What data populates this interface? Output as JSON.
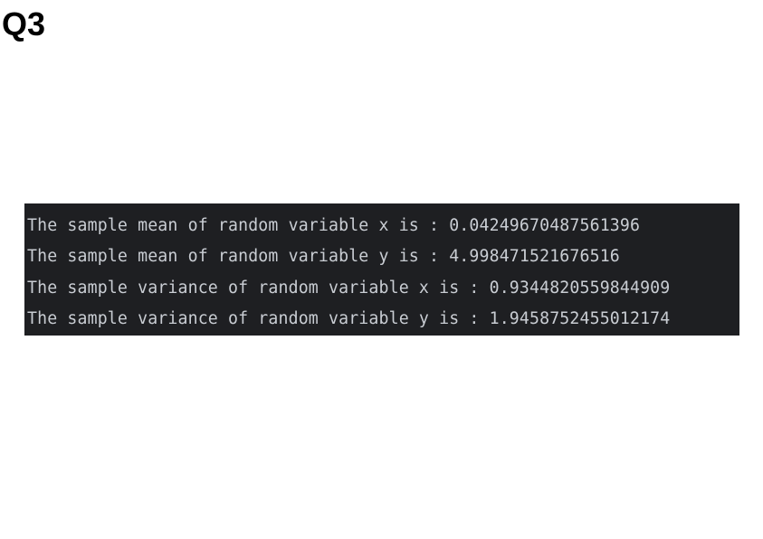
{
  "heading": "Q3",
  "console": {
    "lines": [
      "The sample mean of random variable x is : 0.04249670487561396",
      "The sample mean of random variable y is : 4.998471521676516",
      "The sample variance of random variable x is : 0.9344820559844909",
      "The sample variance of random variable y is : 1.9458752455012174"
    ]
  },
  "colors": {
    "console_background": "#1e1f22",
    "console_text": "#c9cdd3",
    "heading_text": "#000000",
    "page_background": "#ffffff"
  }
}
